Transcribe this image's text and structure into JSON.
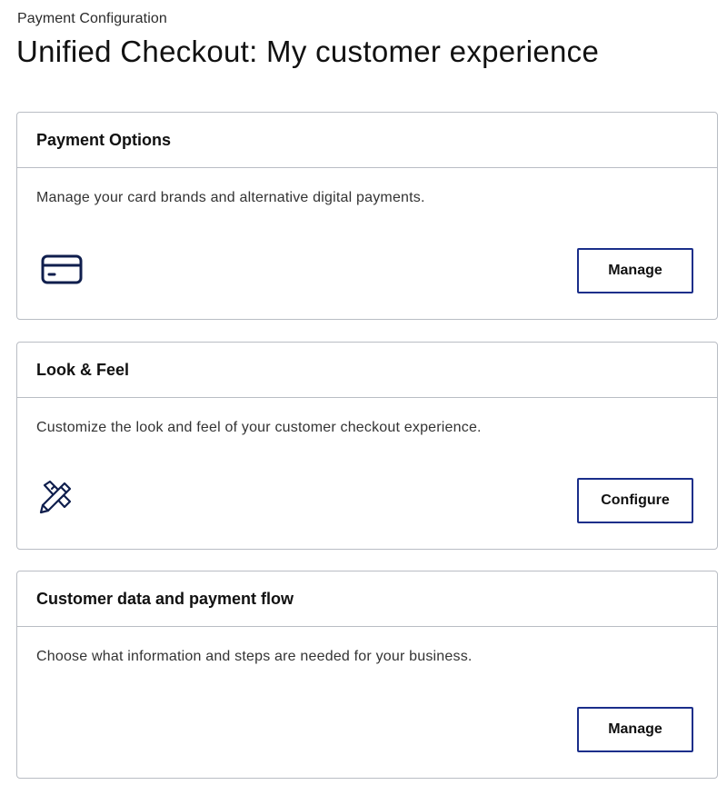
{
  "breadcrumb": "Payment Configuration",
  "title": "Unified Checkout: My customer experience",
  "colors": {
    "accent": "#1a2e8a",
    "border": "#b9bdc4",
    "icon": "#0f1e4d"
  },
  "cards": [
    {
      "heading": "Payment Options",
      "description": "Manage your card brands and alternative digital payments.",
      "icon": "credit-card-icon",
      "button_label": "Manage"
    },
    {
      "heading": "Look & Feel",
      "description": "Customize the look and feel of your customer checkout experience.",
      "icon": "pencil-ruler-icon",
      "button_label": "Configure"
    },
    {
      "heading": "Customer data and payment flow",
      "description": "Choose what information and steps are needed for your business.",
      "button_label": "Manage"
    }
  ]
}
